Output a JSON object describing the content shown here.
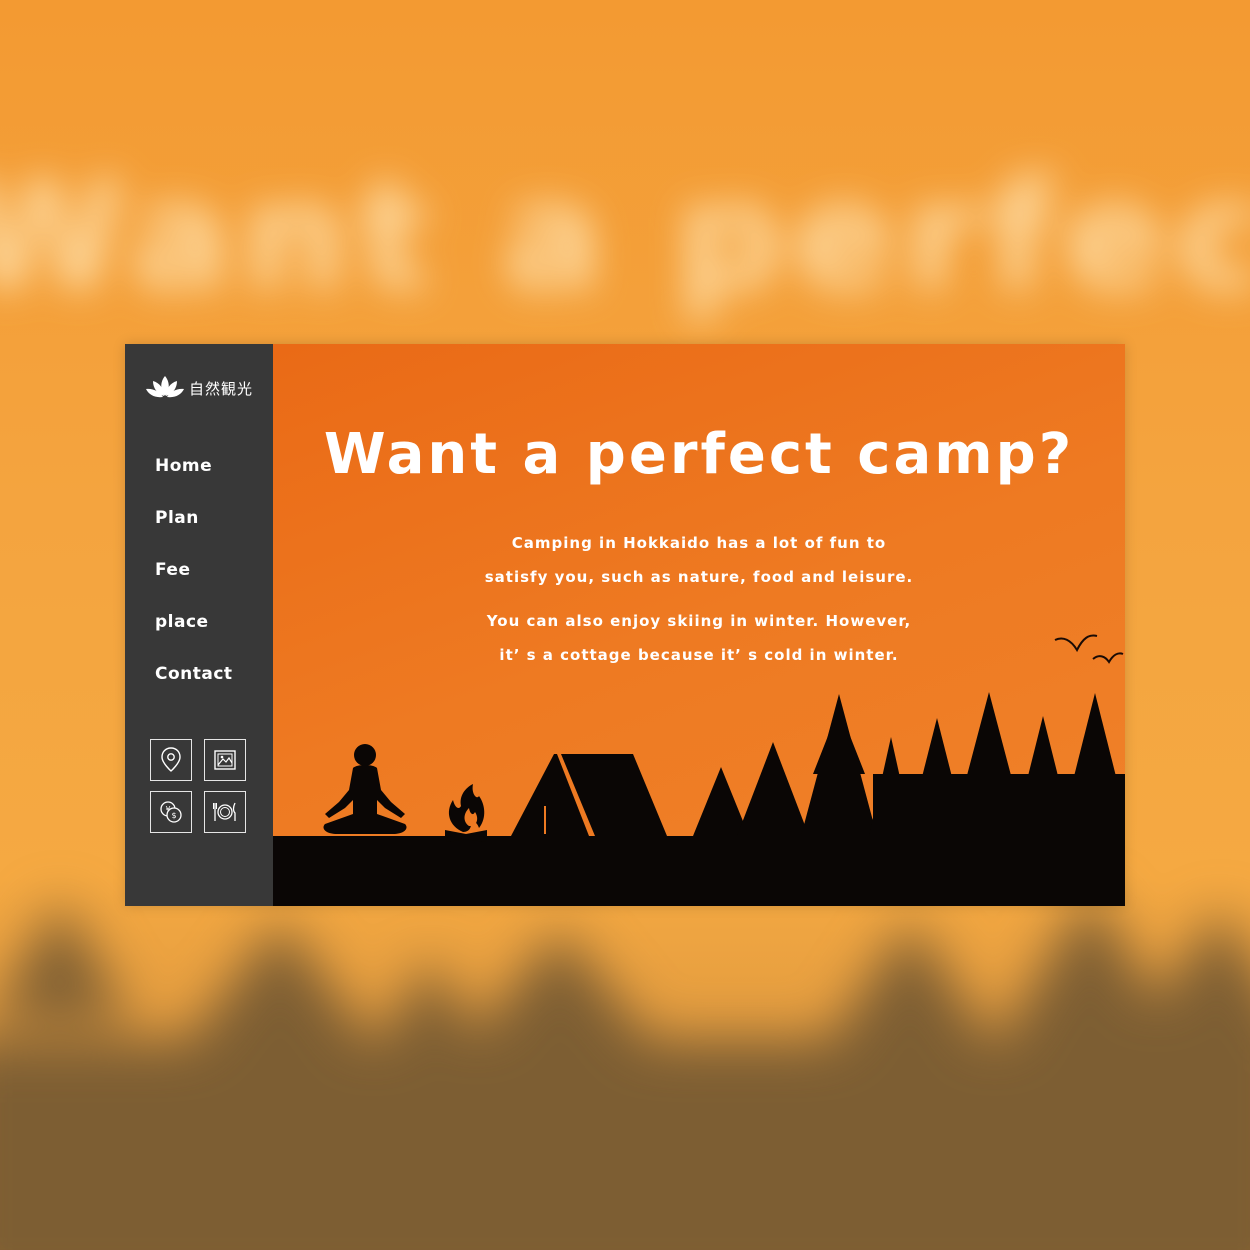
{
  "brand": {
    "logo_text": "自然観光"
  },
  "nav": {
    "items": [
      "Home",
      "Plan",
      "Fee",
      "place",
      "Contact"
    ]
  },
  "icons": [
    "map-pin-icon",
    "image-icon",
    "currency-icon",
    "dining-icon"
  ],
  "hero": {
    "title": "Want a perfect camp?",
    "para1_line1": "Camping in Hokkaido has a lot of fun to",
    "para1_line2": "satisfy you, such as nature, food and leisure.",
    "para2_line1": "You can also enjoy skiing in winter. However,",
    "para2_line2": "it’ s a cottage because it’ s cold in winter."
  },
  "backdrop": {
    "title": "Want a perfect camp?"
  },
  "colors": {
    "sidebar": "#383838",
    "accent": "#ee7a22",
    "silhouette": "#0a0605",
    "text": "#ffffff"
  }
}
